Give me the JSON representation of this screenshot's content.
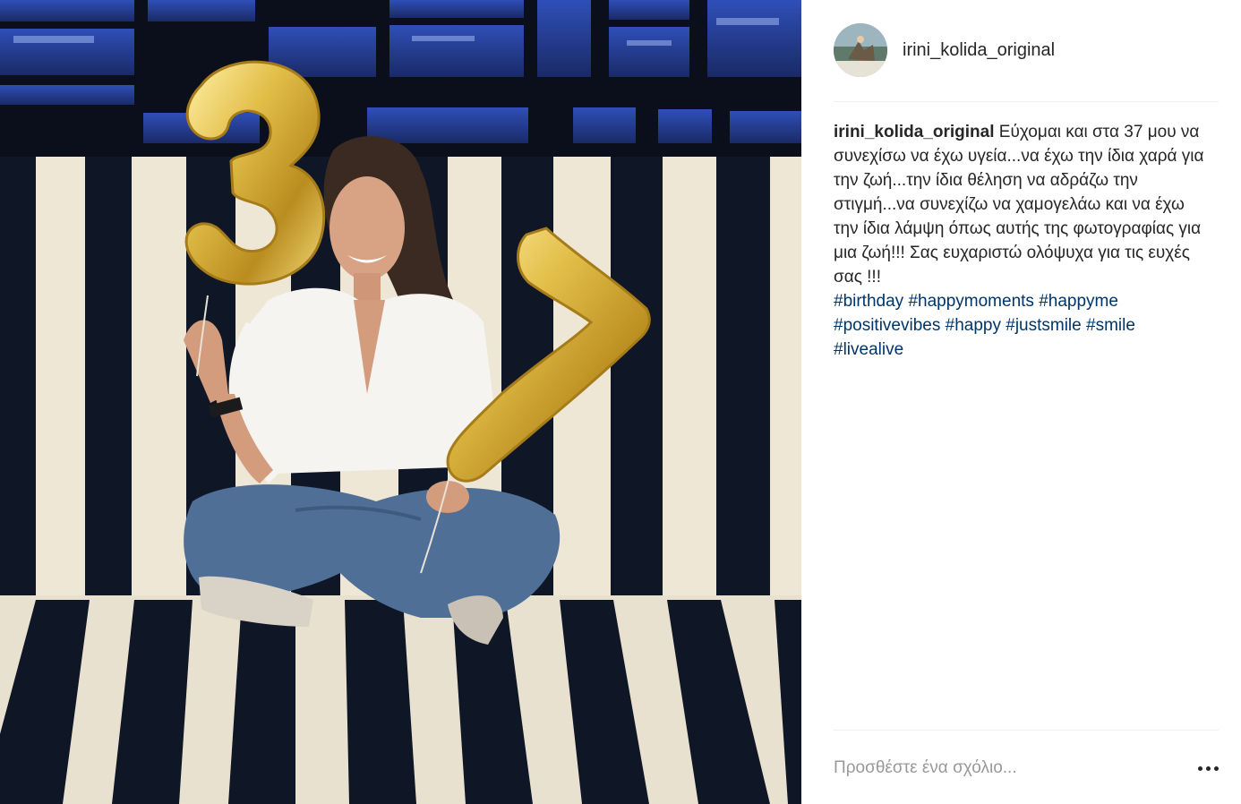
{
  "post": {
    "author": "irini_kolida_original",
    "caption_text": "Εύχομαι και στα 37 μου να συνεχίσω να έχω υγεία...να έχω την ίδια χαρά για την ζωή...την ίδια θέληση να αδράζω την στιγμή...να συνεχίζω να χαμογελάω και να έχω την ίδια λάμψη όπως αυτής της φωτογραφίας για μια ζωή!!! Σας ευχαριστώ ολόψυχα για τις ευχές σας !!!",
    "hashtags": [
      "#birthday",
      "#happymoments",
      "#happyme",
      "#positivevibes",
      "#happy",
      "#justsmile",
      "#smile",
      "#livealive"
    ]
  },
  "comment": {
    "placeholder": "Προσθέστε ένα σχόλιο..."
  },
  "icons": {
    "more": "more-options-icon"
  },
  "colors": {
    "hashtag": "#003569",
    "balloon": "#d4af37",
    "stripe_dark": "#0f1626",
    "stripe_light": "#efe7d6"
  }
}
